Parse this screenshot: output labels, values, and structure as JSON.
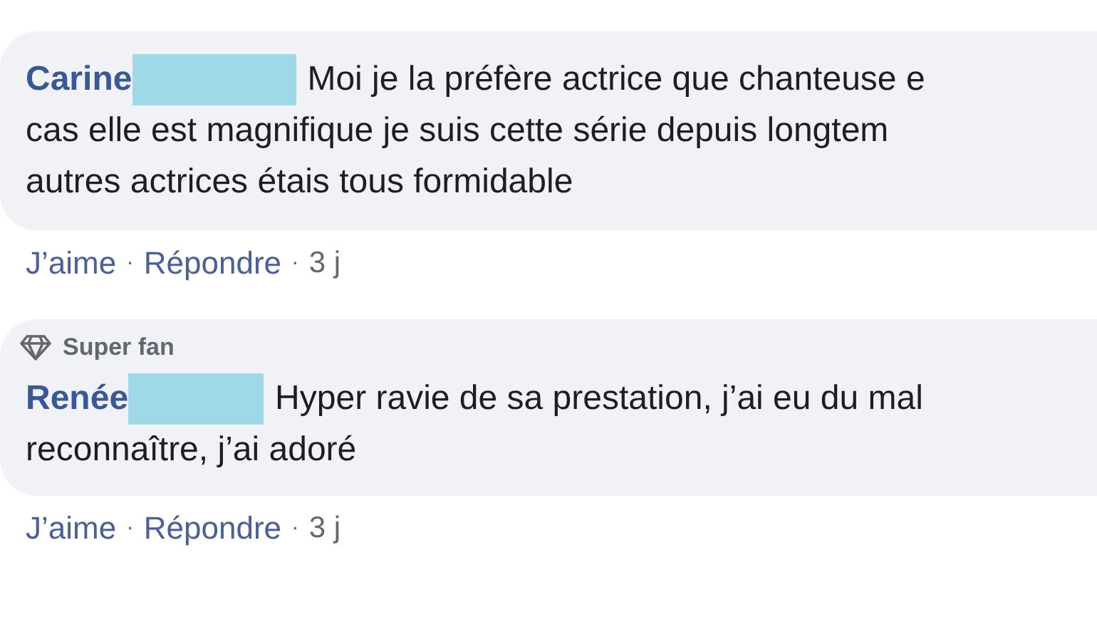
{
  "comments": [
    {
      "author": "Carine",
      "redacted": true,
      "lines": [
        "Moi je la préfère actrice que chanteuse e",
        "cas elle est magnifique je suis cette série depuis longtem",
        "autres actrices étais tous formidable"
      ],
      "footer": [
        {
          "kind": "link",
          "text": "J’aime"
        },
        {
          "kind": "separator",
          "text": "·"
        },
        {
          "kind": "link",
          "text": "Répondre"
        },
        {
          "kind": "separator",
          "text": "·"
        },
        {
          "kind": "time",
          "text": "3 j"
        }
      ]
    },
    {
      "badge": "Super fan",
      "author": "Renée",
      "redacted": true,
      "lines": [
        "Hyper ravie de sa prestation, j’ai eu du mal",
        "reconnaître, j’ai adoré"
      ],
      "footer": [
        {
          "kind": "link",
          "text": "J’aime"
        },
        {
          "kind": "separator",
          "text": "·"
        },
        {
          "kind": "link",
          "text": "Répondre"
        },
        {
          "kind": "separator",
          "text": "·"
        },
        {
          "kind": "time",
          "text": "3 j"
        }
      ]
    }
  ]
}
